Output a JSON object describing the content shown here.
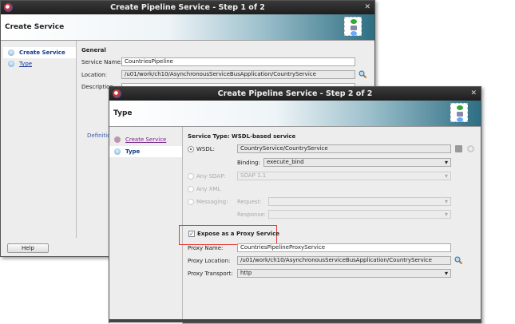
{
  "step1": {
    "title": "Create Pipeline Service - Step 1 of 2",
    "header": "Create Service",
    "nav": [
      "Create Service",
      "Type"
    ],
    "section": "General",
    "service_name_label": "Service Name:",
    "service_name": "CountriesPipeline",
    "location_label": "Location:",
    "location": "/u01/work/ch10/AsynchronousServiceBusApplication/CountryService",
    "description_label": "Description",
    "definition_label": "Definitio",
    "help": "Help"
  },
  "step2": {
    "title": "Create Pipeline Service - Step 2 of 2",
    "header": "Type",
    "nav": [
      "Create Service",
      "Type"
    ],
    "service_type": "Service Type: WSDL-based service",
    "wsdl_label": "WSDL:",
    "wsdl": "CountryService/CountryService",
    "binding_label": "Binding:",
    "binding": "execute_bind",
    "any_soap_label": "Any SOAP:",
    "any_soap": "SOAP 1.1",
    "any_xml_label": "Any XML",
    "messaging_label": "Messaging:",
    "request_label": "Request:",
    "response_label": "Response:",
    "expose_label": "Expose as a Proxy Service",
    "expose_checked": true,
    "proxy_name_label": "Proxy Name:",
    "proxy_name": "CountriesPipelineProxyService",
    "proxy_location_label": "Proxy Location:",
    "proxy_location": "/u01/work/ch10/AsynchronousServiceBusApplication/CountryService",
    "proxy_transport_label": "Proxy Transport:",
    "proxy_transport": "http"
  },
  "colors": {
    "highlight": "#e53935",
    "link": "#1a3d9c"
  }
}
